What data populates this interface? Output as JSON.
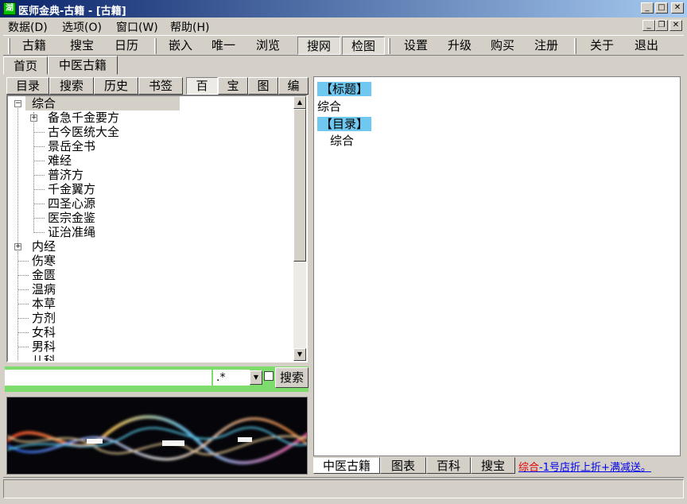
{
  "window": {
    "title": "医师金典-古籍 - [古籍]",
    "icon_text": "湖"
  },
  "menu": [
    "数据(D)",
    "选项(O)",
    "窗口(W)",
    "帮助(H)"
  ],
  "toolbar": {
    "group1": [
      "古籍",
      "搜宝",
      "日历"
    ],
    "group2": [
      "嵌入",
      "唯一",
      "浏览"
    ],
    "group3": [
      "搜网",
      "检图"
    ],
    "group4": [
      "设置",
      "升级",
      "购买",
      "注册"
    ],
    "group5": [
      "关于",
      "退出"
    ]
  },
  "doc_tabs": [
    "首页",
    "中医古籍"
  ],
  "left_tabs": [
    "目录",
    "搜索",
    "历史",
    "书签"
  ],
  "left_tabs2": [
    "百",
    "宝",
    "图",
    "编"
  ],
  "tree": {
    "root_selected": "综合",
    "children": [
      "备急千金要方",
      "古今医统大全",
      "景岳全书",
      "难经",
      "普济方",
      "千金翼方",
      "四圣心源",
      "医宗金鉴",
      "证治准绳"
    ],
    "siblings": [
      "内经",
      "伤寒",
      "金匮",
      "温病",
      "本草",
      "方剂",
      "女科",
      "男科",
      "儿科"
    ]
  },
  "search": {
    "value": "",
    "regex": ".*",
    "button": "搜索"
  },
  "content": {
    "title_tag": "【标题】",
    "title_value": "综合",
    "toc_tag": "【目录】",
    "toc_value": "综合"
  },
  "bottom_tabs": [
    "中医古籍",
    "图表",
    "百科",
    "搜宝"
  ],
  "ad": {
    "red": "综合",
    "rest": "-1号店折上折+满减送。"
  },
  "colors": {
    "accent_tag": "#6fc8f0",
    "search_bg": "#7ddc6c",
    "title_bar": "#0a246a"
  }
}
